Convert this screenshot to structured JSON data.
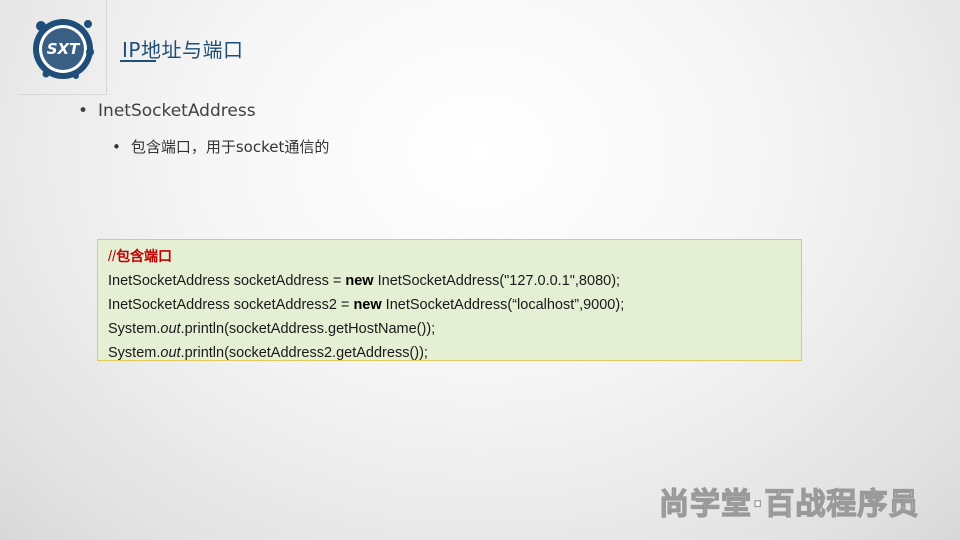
{
  "logo": {
    "text": "SXT",
    "colors": {
      "ring": "#1f4e79",
      "inner": "#3a5f85"
    }
  },
  "header": {
    "title": "IP地址与端口"
  },
  "bullets": {
    "level1": "InetSocketAddress",
    "level2": "包含端口，用于socket通信的"
  },
  "code": {
    "comment_slashes": "//",
    "comment_text": "包含端口",
    "line1": {
      "a": "InetSocketAddress socketAddress = ",
      "kw": "new",
      "b": " InetSocketAddress(\"127.0.0.1\",8080);"
    },
    "line2": {
      "a": "InetSocketAddress socketAddress2 = ",
      "kw": "new",
      "b": " InetSocketAddress(“localhost”,9000);"
    },
    "line3": {
      "a": "System.",
      "italic": "out",
      "b": ".println(socketAddress.getHostName());"
    },
    "line4": {
      "a": "System.",
      "italic": "out",
      "b": ".println(socketAddress2.getAddress());"
    }
  },
  "watermark": {
    "text": "尚学堂·百战程序员"
  },
  "colors": {
    "title": "#1f4e79",
    "comment": "#c00000",
    "code_bg": "#e4efd3",
    "code_border": "#e6c85a"
  }
}
